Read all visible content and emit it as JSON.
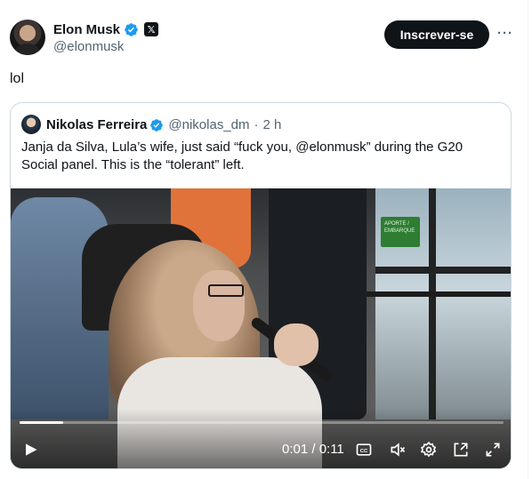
{
  "author": {
    "name": "Elon Musk",
    "handle": "@elonmusk",
    "affiliation_icon": "x-logo-icon"
  },
  "actions": {
    "subscribe_label": "Inscrever-se",
    "more_label": "···"
  },
  "tweet": {
    "text": "lol"
  },
  "quoted": {
    "name": "Nikolas Ferreira",
    "handle": "@nikolas_dm",
    "separator": "·",
    "time": "2 h",
    "text": "Janja da Silva, Lula’s wife, just said “fuck you, @elonmusk” during the G20 Social panel. This is the “tolerant” left."
  },
  "video": {
    "sign_text": "APORTE / EMBARQUE",
    "time_display": "0:01 / 0:11",
    "progress_fraction": 0.09,
    "controls": [
      "play-icon",
      "captions-icon",
      "mute-icon",
      "settings-icon",
      "pip-icon",
      "fullscreen-icon"
    ]
  },
  "colors": {
    "verified": "#1d9bf0",
    "text_primary": "#0f1419",
    "text_secondary": "#536471",
    "border": "#cfd9de"
  }
}
